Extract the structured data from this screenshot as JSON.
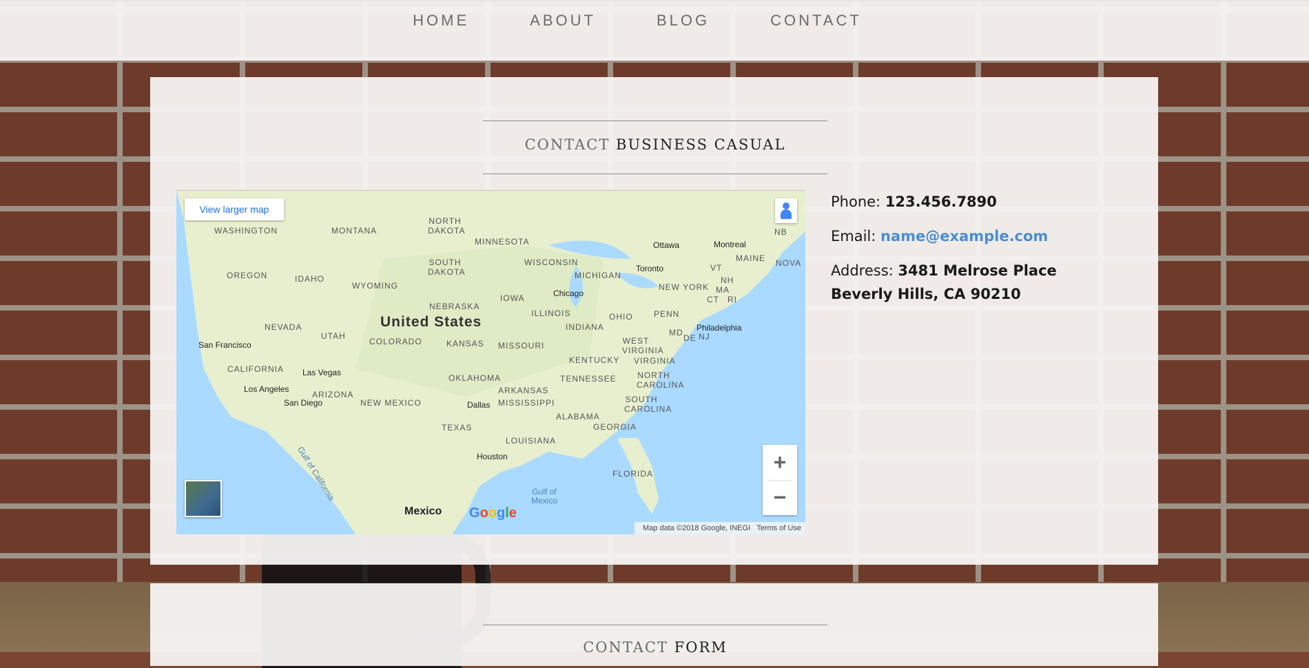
{
  "nav": {
    "items": [
      "HOME",
      "ABOUT",
      "BLOG",
      "CONTACT"
    ]
  },
  "contact_section": {
    "title_light": "CONTACT",
    "title_bold": "BUSINESS CASUAL"
  },
  "map": {
    "view_larger_label": "View larger map",
    "zoom_in_label": "+",
    "zoom_out_label": "−",
    "attribution": "Map data ©2018 Google, INEGI",
    "terms": "Terms of Use",
    "google_logo": "Google",
    "country_label": "United States",
    "neighbor_label": "Mexico",
    "water_label_gulf_of_mexico": "Gulf of\nMexico",
    "water_label_gulf_of_california": "Gulf of California",
    "states": [
      "WASHINGTON",
      "MONTANA",
      "NORTH DAKOTA",
      "MINNESOTA",
      "OREGON",
      "IDAHO",
      "SOUTH DAKOTA",
      "WISCONSIN",
      "MICHIGAN",
      "WYOMING",
      "NEBRASKA",
      "IOWA",
      "NEVADA",
      "UTAH",
      "COLORADO",
      "KANSAS",
      "ILLINOIS",
      "INDIANA",
      "OHIO",
      "PENN",
      "CALIFORNIA",
      "MISSOURI",
      "KENTUCKY",
      "WEST VIRGINIA",
      "VIRGINIA",
      "ARIZONA",
      "NEW MEXICO",
      "OKLAHOMA",
      "ARKANSAS",
      "TENNESSEE",
      "NORTH CAROLINA",
      "MISSISSIPPI",
      "ALABAMA",
      "GEORGIA",
      "SOUTH CAROLINA",
      "TEXAS",
      "LOUISIANA",
      "FLORIDA",
      "NEW YORK",
      "VT",
      "NH",
      "MA",
      "CT",
      "RI",
      "MAINE",
      "NB",
      "NOVA",
      "MD",
      "DE",
      "NJ"
    ],
    "cities": [
      "San Francisco",
      "Las Vegas",
      "Los Angeles",
      "San Diego",
      "Chicago",
      "Toronto",
      "Ottawa",
      "Montreal",
      "Philadelphia",
      "Dallas",
      "Houston"
    ]
  },
  "contact_info": {
    "phone_label": "Phone: ",
    "phone": "123.456.7890",
    "email_label": "Email: ",
    "email": "name@example.com",
    "address_label": "Address: ",
    "address_line1": "3481 Melrose Place",
    "address_line2": "Beverly Hills, CA 90210"
  },
  "form_section": {
    "title_light": "CONTACT",
    "title_bold": "FORM"
  },
  "colors": {
    "link": "#4a8ed1",
    "panel": "#f7f4f3",
    "map_water": "#aadaff",
    "map_land": "#e8efcf"
  }
}
